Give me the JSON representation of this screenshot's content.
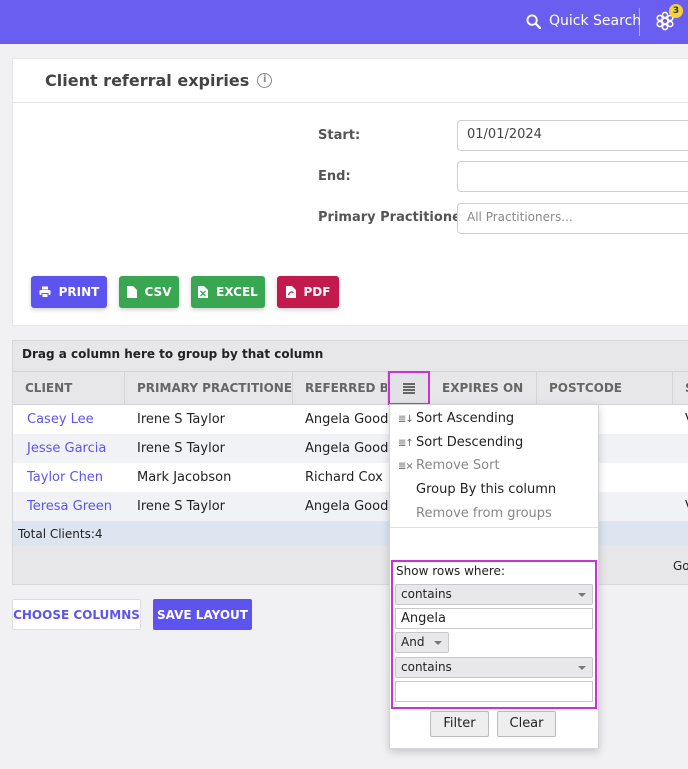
{
  "topbar": {
    "quick_search": "Quick Search",
    "notification_count": "3",
    "bg_color": "#6a5ef0"
  },
  "report": {
    "title": "Client referral expiries",
    "start_label": "Start:",
    "start_value": "01/01/2024",
    "end_label": "End:",
    "end_value": "",
    "practitioner_label": "Primary Practitioner:",
    "practitioner_placeholder": "All Practitioners...",
    "buttons": {
      "print": "PRINT",
      "csv": "CSV",
      "excel": "EXCEL",
      "pdf": "PDF"
    }
  },
  "grid": {
    "group_hint": "Drag a column here to group by that column",
    "columns": [
      "CLIENT",
      "PRIMARY PRACTITIONER",
      "REFERRED BY",
      "",
      "EXPIRES ON",
      "POSTCODE",
      "S"
    ],
    "rows": [
      {
        "client": "Casey Lee",
        "practitioner": "Irene S Taylor",
        "referred_by": "Angela Good",
        "extra": "V"
      },
      {
        "client": "Jesse Garcia",
        "practitioner": "Irene S Taylor",
        "referred_by": "Angela Good",
        "extra": ""
      },
      {
        "client": "Taylor Chen",
        "practitioner": "Mark Jacobson",
        "referred_by": "Richard Cox",
        "extra": ""
      },
      {
        "client": "Teresa Green",
        "practitioner": "Irene S Taylor",
        "referred_by": "Angela Good",
        "extra": "V"
      }
    ],
    "footer": "Total Clients:4",
    "pager_text": "Go"
  },
  "actions": {
    "choose_columns": "CHOOSE COLUMNS",
    "save_layout": "SAVE LAYOUT"
  },
  "column_menu": {
    "sort_ascending": "Sort Ascending",
    "sort_descending": "Sort Descending",
    "remove_sort": "Remove Sort",
    "group_by": "Group By this column",
    "remove_groups": "Remove from groups",
    "filter": {
      "title": "Show rows where:",
      "operator1": "contains",
      "value1": "Angela",
      "logic": "And",
      "operator2": "contains",
      "value2": "",
      "filter_button": "Filter",
      "clear_button": "Clear"
    },
    "highlight_color": "#c634d8"
  }
}
